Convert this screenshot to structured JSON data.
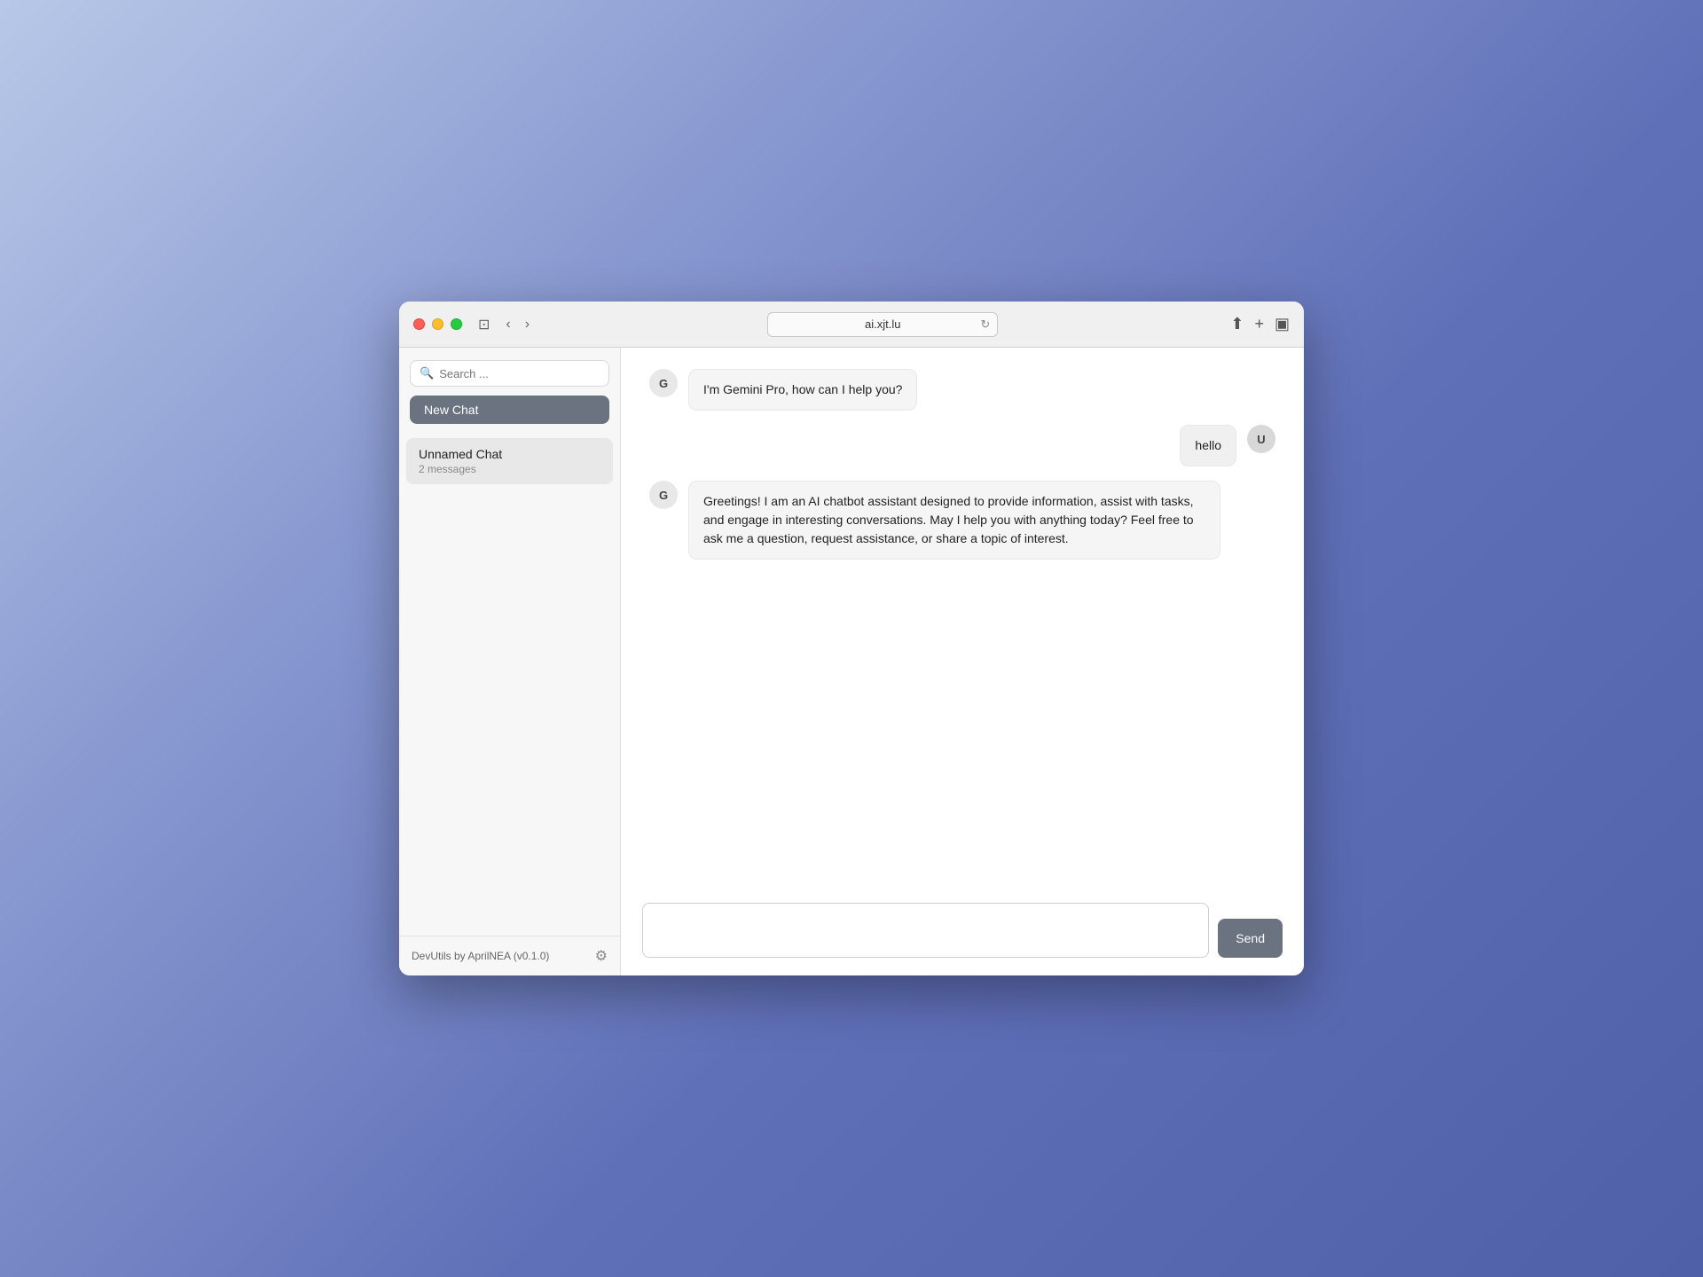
{
  "browser": {
    "url": "ai.xjt.lu",
    "traffic_lights": {
      "close_label": "close",
      "minimize_label": "minimize",
      "maximize_label": "maximize"
    },
    "back_arrow": "‹",
    "forward_arrow": "›",
    "sidebar_toggle": "⊡",
    "toolbar": {
      "share": "↑",
      "new_tab": "+",
      "view": "⊞"
    }
  },
  "sidebar": {
    "search_placeholder": "Search ...",
    "new_chat_label": "New Chat",
    "chat_items": [
      {
        "title": "Unnamed Chat",
        "subtitle": "2 messages"
      }
    ],
    "footer_text": "DevUtils by AprilNEA (v0.1.0)",
    "settings_icon": "⚙"
  },
  "chat": {
    "messages": [
      {
        "id": "msg1",
        "sender": "G",
        "sender_type": "gemini",
        "text": "I'm Gemini Pro, how can I help you?"
      },
      {
        "id": "msg2",
        "sender": "U",
        "sender_type": "user",
        "text": "hello"
      },
      {
        "id": "msg3",
        "sender": "G",
        "sender_type": "gemini",
        "text": "Greetings! I am an AI chatbot assistant designed to provide information, assist with tasks, and engage in interesting conversations. May I help you with anything today? Feel free to ask me a question, request assistance, or share a topic of interest."
      }
    ],
    "input_placeholder": "",
    "send_button_label": "Send"
  }
}
